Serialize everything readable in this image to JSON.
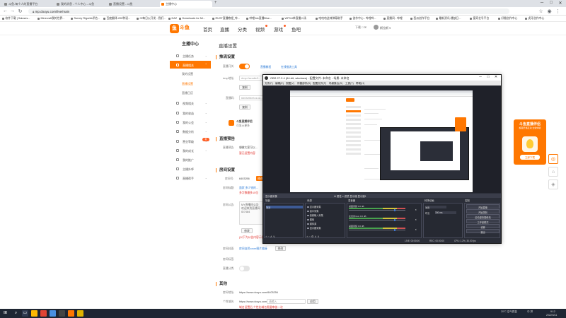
{
  "browser": {
    "tabs": [
      {
        "title": "斗鱼-每个人的直播平台"
      },
      {
        "title": "我的消息 - 个人中心 - 斗鱼"
      },
      {
        "title": "直播设置 - 斗鱼"
      },
      {
        "title": "主播中心"
      }
    ],
    "url": "mp.douyu.com/live/main",
    "bookmarks": [
      "软件下载 | Saluses...",
      "Minecraft我的世界...",
      "Survey Rigorità评估...",
      "百度翻译-200种语...",
      "Ol每日火开发 - 我们...",
      "DAZ",
      "Downloads for Mi...",
      "RUST直播教程_哔...",
      "哔哩link直播Blue...",
      "WP3.8单直播入场",
      "哈哈哈这神弹幕助手",
      "创作中心 - 哔哩哔...",
      "直播间 - 哔哩",
      "西瓜创作平台",
      "最新资讯-播放日...",
      "爱奇艺号平台",
      "好看创作中心",
      "虎牙创作中心"
    ],
    "window_controls": [
      "─",
      "□",
      "✕"
    ]
  },
  "site": {
    "logo": "斗鱼",
    "nav": [
      "首页",
      "直播",
      "分类",
      "视频",
      "游戏",
      "鱼吧"
    ],
    "header_right": "下载  □  ✉",
    "username": "斯拉斯 ▾"
  },
  "sidebar": {
    "title": "主播中心",
    "items": [
      {
        "label": "主播任务",
        "expanded": false
      },
      {
        "label": "直播相关",
        "expanded": true
      }
    ],
    "subitems": [
      "我的设置",
      "直播设置",
      "直播日历"
    ],
    "items_after": [
      {
        "label": "视频相关"
      },
      {
        "label": "我的收益"
      },
      {
        "label": "我的公会"
      },
      {
        "label": "数据分析"
      },
      {
        "label": "营业等级"
      },
      {
        "label": "我的成长"
      },
      {
        "label": "我的推广"
      },
      {
        "label": "主播外呼"
      },
      {
        "label": "直播帮手"
      }
    ],
    "badge": "新"
  },
  "main": {
    "page_title": "直播设置",
    "sections": {
      "push": "推流设置",
      "preview": "直播预告",
      "room": "房间设置",
      "other": "其他"
    },
    "push": {
      "toggle_label": "直播开关:",
      "toggle_on": true,
      "link1": "直播教程",
      "link2": "在线推流工具",
      "rtmp_label": "rtmp地址:",
      "rtmp_value": "rtmp://sendtc3...",
      "copy1": "复制",
      "code_label": "直播码:",
      "code_value": "6403256rSnLnd...",
      "copy2": "复制",
      "promo_title": "斗鱼直播伴侣",
      "promo_sub": "可显示更多"
    },
    "preview": {
      "label": "直播预告:",
      "value": "想做大家可以...",
      "warning": "暂无设置内容"
    },
    "room": {
      "id_label": "房间号:",
      "id_value": "6403256",
      "id_btn": "修改",
      "name_label": "房间标题:",
      "name_link": "面家 多少钱的...",
      "name_warn": "多字数最多15位",
      "notice_label": "房间公告:",
      "notice_text": "MY直播间公告\n欢迎来到直播间\nID7484",
      "notice_btn": "修改",
      "notice_warn": "(以下为公告内容示例)",
      "cover_label": "房间封面:",
      "cover_link": "房间自然cover图片链接",
      "cover_btn": "修改",
      "extra1": "房间标签:",
      "extra2": "直播分类:"
    },
    "other": {
      "link_label": "房间地址:",
      "link_value": "https://www.douyu.com/6403256",
      "share_label": "个性域名:",
      "share_value": "https://www.douyu.com/",
      "share_input_placeholder": "请输入",
      "share_btn": "应用",
      "share_warn": "域名设置后,个性化域名需要审核一次"
    }
  },
  "obs": {
    "title": "OBS 27.2.4 (64-bit, windows) - 配置文件: 未命名 - 场景: 未命名",
    "menu": [
      "文件(F)",
      "编辑(E)",
      "视图(V)",
      "停靠部件(D)",
      "配置文件(P)",
      "场景集合(S)",
      "工具(T)",
      "帮助(H)"
    ],
    "controls_bar": "显示器采集",
    "controls_bar_props": "⚙ 属性   ≡ 滤镜   显示器  显示器1",
    "docks": [
      "场景",
      "来源",
      "混音器",
      "转场动画",
      "控制"
    ],
    "scenes": [
      "场景"
    ],
    "sources": [
      "显示器采集",
      "窗口采集",
      "音频输入采集",
      "图像",
      "媒体源",
      "显示器采集"
    ],
    "mixer": [
      {
        "name": "桌面音频  0.0 dB"
      },
      {
        "name": "麦克风/Aux  0.0 dB"
      },
      {
        "name": "桌面音频  0.0 dB"
      }
    ],
    "transition": {
      "type": "淡出",
      "duration_label": "时长",
      "duration": "300 ms"
    },
    "controls": [
      "开始直播",
      "开始录制",
      "启动虚拟摄像机",
      "工作室模式",
      "设置",
      "退出"
    ],
    "status": [
      "LIVE: 00:00:00",
      "REC: 00:00:00",
      "CPU: 1.2%, 30.00 fps"
    ]
  },
  "promo": {
    "title": "斗鱼直播伴侣",
    "sub": "超强开播互动 全新体验",
    "btn": "立即下载"
  },
  "right_side": [
    "◎",
    "⌂",
    "◈"
  ],
  "taskbar": {
    "tray": "中  拼",
    "weather": "20°C 空气质量",
    "time": "9:12",
    "date": "2022/4/11"
  }
}
